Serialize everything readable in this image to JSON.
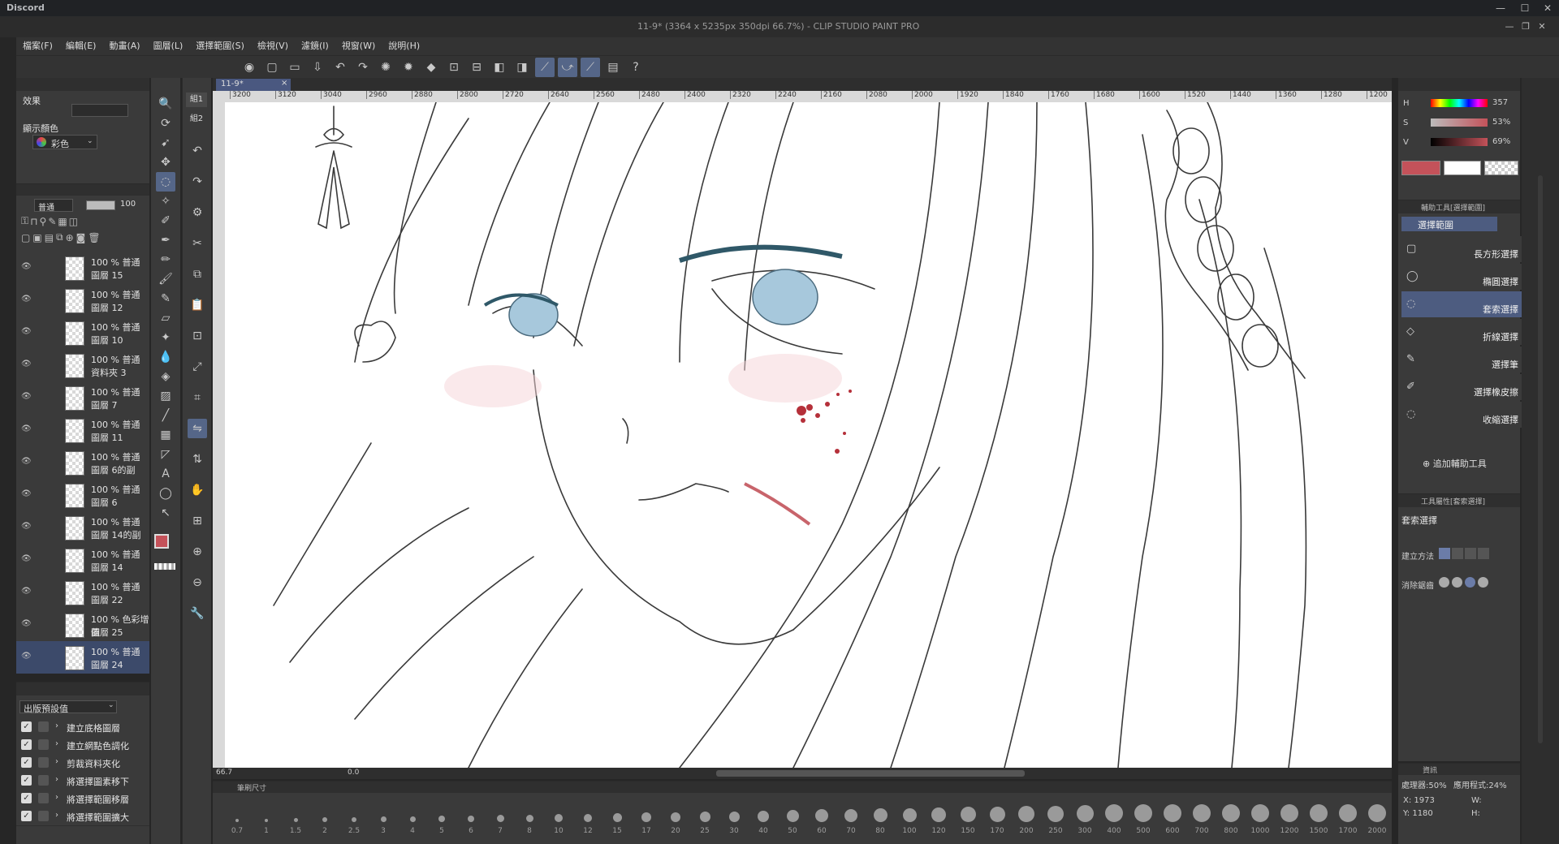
{
  "window": {
    "app_name": "Discord",
    "doc_title": "11-9* (3364 x 5235px 350dpi 66.7%) - CLIP STUDIO PAINT PRO"
  },
  "menu": [
    "檔案(F)",
    "編輯(E)",
    "動畫(A)",
    "圖層(L)",
    "選擇範圍(S)",
    "檢視(V)",
    "濾鏡(I)",
    "視窗(W)",
    "說明(H)"
  ],
  "left_top": {
    "effect_label": "效果",
    "display_color_label": "顯示顏色",
    "color_mode": "彩色"
  },
  "layer_panel": {
    "blend_mode": "普通",
    "opacity": "100",
    "layers": [
      {
        "line1": "100 % 普通",
        "line2": "圖層 15"
      },
      {
        "line1": "100 % 普通",
        "line2": "圖層 12"
      },
      {
        "line1": "100 % 普通",
        "line2": "圖層 10"
      },
      {
        "line1": "100 % 普通",
        "line2": "資料夾 3"
      },
      {
        "line1": "100 % 普通",
        "line2": "圖層 7"
      },
      {
        "line1": "100 % 普通",
        "line2": "圖層 11"
      },
      {
        "line1": "100 % 普通",
        "line2": "圖層 6的副"
      },
      {
        "line1": "100 % 普通",
        "line2": "圖層 6"
      },
      {
        "line1": "100 % 普通",
        "line2": "圖層 14的副"
      },
      {
        "line1": "100 % 普通",
        "line2": "圖層 14"
      },
      {
        "line1": "100 % 普通",
        "line2": "圖層 22"
      },
      {
        "line1": "100 % 色彩增值",
        "line2": "圖層 25"
      },
      {
        "line1": "100 % 普通",
        "line2": "圖層 24"
      }
    ]
  },
  "auto_actions": {
    "set_name": "出版預設值",
    "items": [
      "建立底格圖層",
      "建立網點色調化",
      "剪裁資料夾化",
      "將選擇圖素移下",
      "將選擇範圍移層",
      "將選擇範圍擴大"
    ]
  },
  "canvas": {
    "tab_label": "11-9*",
    "ruler_ticks": [
      "3200",
      "3120",
      "3040",
      "2960",
      "2880",
      "2800",
      "2720",
      "2640",
      "2560",
      "2480",
      "2400",
      "2320",
      "2240",
      "2160",
      "2080",
      "2000",
      "1920",
      "1840",
      "1760",
      "1680",
      "1600",
      "1520",
      "1440",
      "1360",
      "1280",
      "1200"
    ],
    "zoom_value": "66.7",
    "angle_value": "0.0"
  },
  "brush_panel": {
    "title": "筆刷尺寸",
    "sizes": [
      "0.7",
      "1",
      "1.5",
      "2",
      "2.5",
      "3",
      "4",
      "5",
      "6",
      "7",
      "8",
      "10",
      "12",
      "15",
      "17",
      "20",
      "25",
      "30",
      "40",
      "50",
      "60",
      "70",
      "80",
      "100",
      "120",
      "150",
      "170",
      "200",
      "250",
      "300",
      "400",
      "500",
      "600",
      "700",
      "800",
      "1000",
      "1200",
      "1500",
      "1700",
      "2000"
    ]
  },
  "color_panel": {
    "h_label": "H",
    "s_label": "S",
    "v_label": "V",
    "h_value": "357",
    "s_value": "53",
    "v_value": "69",
    "main_color": "#c4525a",
    "sub_color": "#ffffff"
  },
  "sub_tool_panel": {
    "header": "輔助工具[選擇範圍]",
    "group": "選擇範圍",
    "items": [
      "長方形選擇",
      "橢圓選擇",
      "套索選擇",
      "折線選擇",
      "選擇筆",
      "選擇橡皮擦",
      "收縮選擇"
    ],
    "add_label": "追加輔助工具"
  },
  "tool_property": {
    "header": "工具屬性[套索選擇]",
    "title": "套索選擇",
    "create_method": "建立方法",
    "antialias": "消除鋸齒"
  },
  "info_panel": {
    "header": "資訊",
    "cpu": "處理器:50%",
    "mem": "應用程式:24%",
    "x": "X: 1973",
    "y": "Y: 1180",
    "w": "W:",
    "h": "H:"
  },
  "icons": [
    "minimize-icon",
    "maximize-icon",
    "close-icon",
    "zoom-icon",
    "hand-icon",
    "lasso-icon",
    "pen-icon",
    "eraser-icon",
    "fill-icon",
    "text-icon",
    "gear-icon"
  ]
}
